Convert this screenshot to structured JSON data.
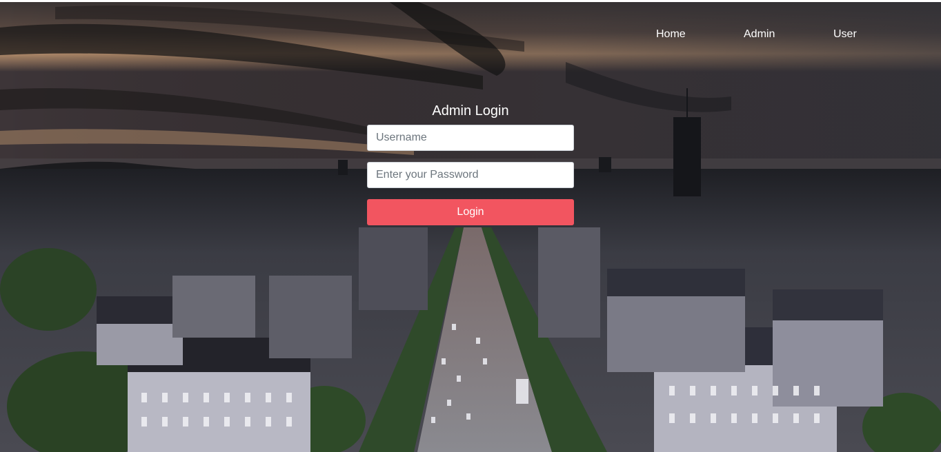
{
  "nav": {
    "items": [
      {
        "label": "Home"
      },
      {
        "label": "Admin"
      },
      {
        "label": "User"
      }
    ]
  },
  "login": {
    "title": "Admin Login",
    "username_placeholder": "Username",
    "password_placeholder": "Enter your Password",
    "submit_label": "Login"
  },
  "colors": {
    "accent": "#f25560",
    "text_on_dark": "#ffffff"
  }
}
